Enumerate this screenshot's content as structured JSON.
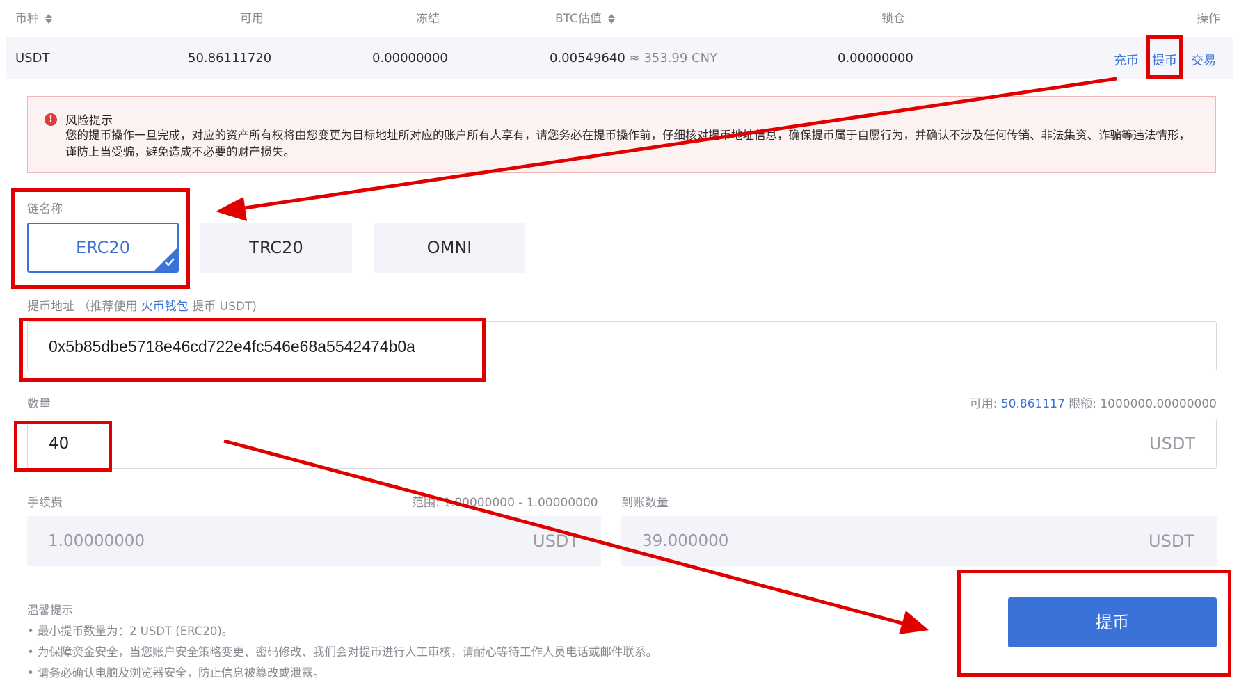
{
  "table": {
    "headers": {
      "currency": "币种",
      "available": "可用",
      "frozen": "冻结",
      "btc_value": "BTC估值",
      "locked": "锁仓",
      "actions": "操作"
    },
    "row": {
      "currency": "USDT",
      "available": "50.86111720",
      "frozen": "0.00000000",
      "btc_value": "0.00549640",
      "cny_value": "≈ 353.99 CNY",
      "locked": "0.00000000",
      "action_deposit": "充币",
      "action_withdraw": "提币",
      "action_trade": "交易"
    }
  },
  "risk": {
    "title": "风险提示",
    "body": "您的提币操作一旦完成，对应的资产所有权将由您变更为目标地址所对应的账户所有人享有，请您务必在提币操作前，仔细核对提币地址信息，确保提币属于自愿行为，并确认不涉及任何传销、非法集资、诈骗等违法情形，谨防上当受骗，避免造成不必要的财产损失。"
  },
  "chain": {
    "label": "链名称",
    "options": [
      "ERC20",
      "TRC20",
      "OMNI"
    ],
    "selected": "ERC20"
  },
  "address": {
    "label": "提币地址",
    "hint_prefix": "（推荐使用",
    "hint_link": "火币钱包",
    "hint_suffix": "提币 USDT)",
    "value": "0x5b85dbe5718e46cd722e4fc546e68a5542474b0a"
  },
  "amount": {
    "label": "数量",
    "available_label": "可用:",
    "available_value": "50.861117",
    "limit_label": "限额:",
    "limit_value": "1000000.00000000",
    "value": "40",
    "unit": "USDT"
  },
  "fee": {
    "label": "手续费",
    "range_label": "范围:",
    "range_value": "1.00000000 - 1.00000000",
    "value": "1.00000000",
    "unit": "USDT"
  },
  "received": {
    "label": "到账数量",
    "value": "39.000000",
    "unit": "USDT"
  },
  "tips": {
    "title": "温馨提示",
    "items": [
      "• 最小提币数量为：2 USDT (ERC20)。",
      "• 为保障资金安全，当您账户安全策略变更、密码修改、我们会对提币进行人工审核，请耐心等待工作人员电话或邮件联系。",
      "• 请务必确认电脑及浏览器安全，防止信息被篡改或泄露。"
    ]
  },
  "submit_label": "提币",
  "colors": {
    "accent": "#3a72d8",
    "annotation": "#e00000",
    "warning_bg": "#fdf2f2",
    "warning_border": "#f3b3b3"
  }
}
